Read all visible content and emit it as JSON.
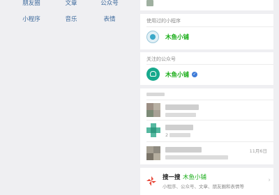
{
  "categories": [
    "朋友圈",
    "文章",
    "公众号",
    "小程序",
    "音乐",
    "表情"
  ],
  "recent_mini_programs": {
    "section_label": "使用过的小程序",
    "item_name": "木鱼小铺"
  },
  "followed_accounts": {
    "section_label": "关注的公众号",
    "item_name": "木鱼小铺",
    "verified_icon": "check-badge"
  },
  "chat_results": {
    "row_2_text": "2",
    "row_3_time": "11月6日"
  },
  "search_one": {
    "title": "搜一搜",
    "keyword": "木鱼小铺",
    "description": "小程序、公众号、文章、朋友圈和表情等",
    "icon": "pinwheel"
  },
  "colors": {
    "brand_green": "#1aad19",
    "link_blue": "#3f6b9d",
    "verified_blue": "#3d7bd8",
    "background": "#efeff2"
  }
}
